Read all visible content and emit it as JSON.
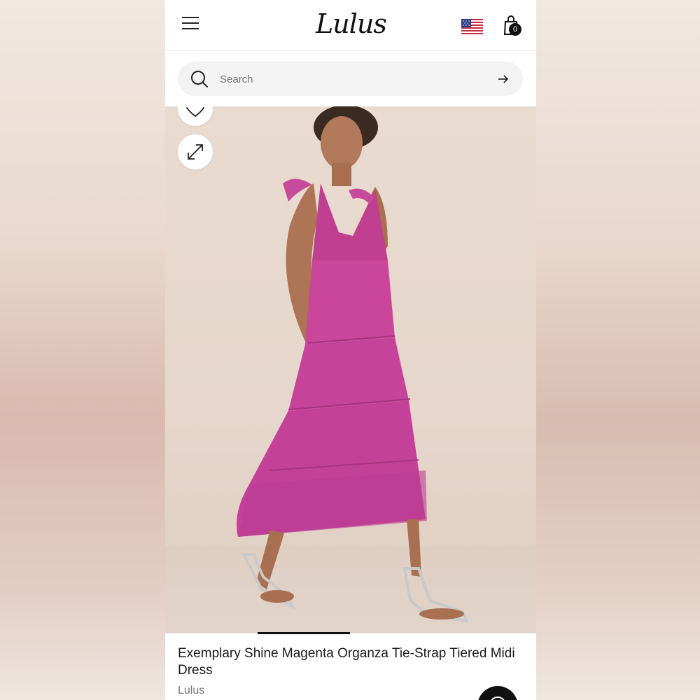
{
  "header": {
    "logo_text": "Lulus",
    "menu_icon": "hamburger-menu-icon",
    "flag_icon": "us-flag-icon",
    "cart_icon": "shopping-bag-icon",
    "cart_count": "0"
  },
  "search": {
    "placeholder": "Search",
    "value": "",
    "search_icon": "search-icon",
    "submit_icon": "arrow-right-icon"
  },
  "gallery": {
    "wishlist_icon": "heart-icon",
    "expand_icon": "expand-icon",
    "image_alt": "Exemplary Shine Magenta Organza Tie-Strap Tiered Midi Dress",
    "active_slide": 1,
    "dress_color": "#c8479a",
    "background_color": "#e8d9ce"
  },
  "product": {
    "title": "Exemplary Shine Magenta Organza Tie-Strap Tiered Midi Dress",
    "brand": "Lulus"
  },
  "chat": {
    "icon": "chat-icon"
  }
}
